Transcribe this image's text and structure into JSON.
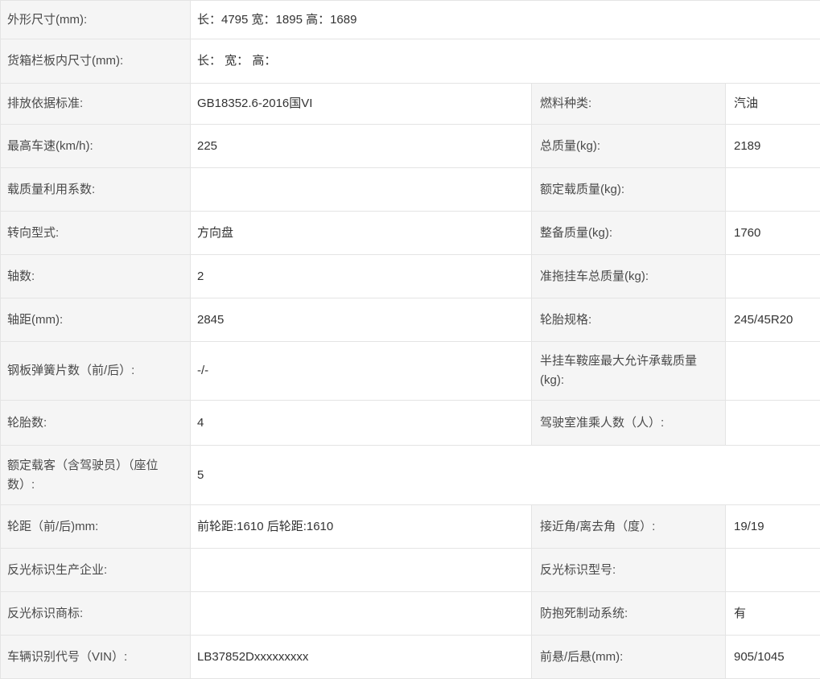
{
  "rows": [
    {
      "k1": "外形尺寸(mm):",
      "v1": "长：4795 宽：1895 高：1689"
    },
    {
      "k1": "货箱栏板内尺寸(mm):",
      "v1": "长：  宽：  高："
    },
    {
      "k1": "排放依据标准:",
      "v1": "GB18352.6-2016国VI",
      "k2": "燃料种类:",
      "v2": "汽油"
    },
    {
      "k1": "最高车速(km/h):",
      "v1": "225",
      "k2": "总质量(kg):",
      "v2": "2189"
    },
    {
      "k1": "载质量利用系数:",
      "v1": "",
      "k2": "额定载质量(kg):",
      "v2": ""
    },
    {
      "k1": "转向型式:",
      "v1": "方向盘",
      "k2": "整备质量(kg):",
      "v2": "1760"
    },
    {
      "k1": "轴数:",
      "v1": "2",
      "k2": "准拖挂车总质量(kg):",
      "v2": ""
    },
    {
      "k1": "轴距(mm):",
      "v1": "2845",
      "k2": "轮胎规格:",
      "v2": "245/45R20"
    },
    {
      "k1": "钢板弹簧片数（前/后）:",
      "v1": "-/-",
      "k2": "半挂车鞍座最大允许承载质量(kg):",
      "v2": ""
    },
    {
      "k1": "轮胎数:",
      "v1": "4",
      "k2": "驾驶室准乘人数（人）:",
      "v2": ""
    },
    {
      "k1": "额定载客（含驾驶员）（座位数）:",
      "v1": "5"
    },
    {
      "k1": "轮距（前/后)mm:",
      "v1": "前轮距:1610 后轮距:1610",
      "k2": "接近角/离去角（度）:",
      "v2": "19/19"
    },
    {
      "k1": "反光标识生产企业:",
      "v1": "",
      "k2": "反光标识型号:",
      "v2": ""
    },
    {
      "k1": "反光标识商标:",
      "v1": "",
      "k2": "防抱死制动系统:",
      "v2": "有"
    },
    {
      "k1": "车辆识别代号（VIN）:",
      "v1": "LB37852Dxxxxxxxxx",
      "k2": "前悬/后悬(mm):",
      "v2": "905/1045"
    }
  ]
}
